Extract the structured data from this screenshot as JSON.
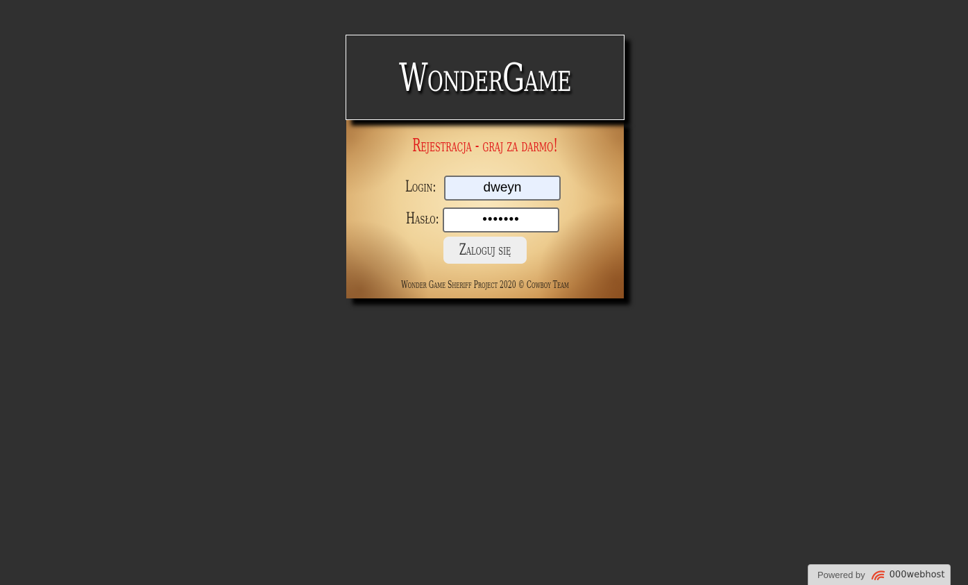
{
  "header": {
    "title": "WonderGame"
  },
  "panel": {
    "heading": "Rejestracja - graj za darmo!",
    "login_label": "Login:",
    "login_value": "dweyn",
    "password_label": "Hasło:",
    "password_value": "•••••••",
    "submit_label": "Zaloguj się",
    "footer": "Wonder Game Sheriff Project 2020 © Cowboy Team"
  },
  "badge": {
    "powered_by": "Powered by",
    "brand": "000webhost",
    "icon": "000webhost-logo-icon",
    "brand_color": "#e8472c"
  },
  "colors": {
    "background": "#303030",
    "heading_red": "#e01818",
    "title_white": "#ffffff"
  }
}
